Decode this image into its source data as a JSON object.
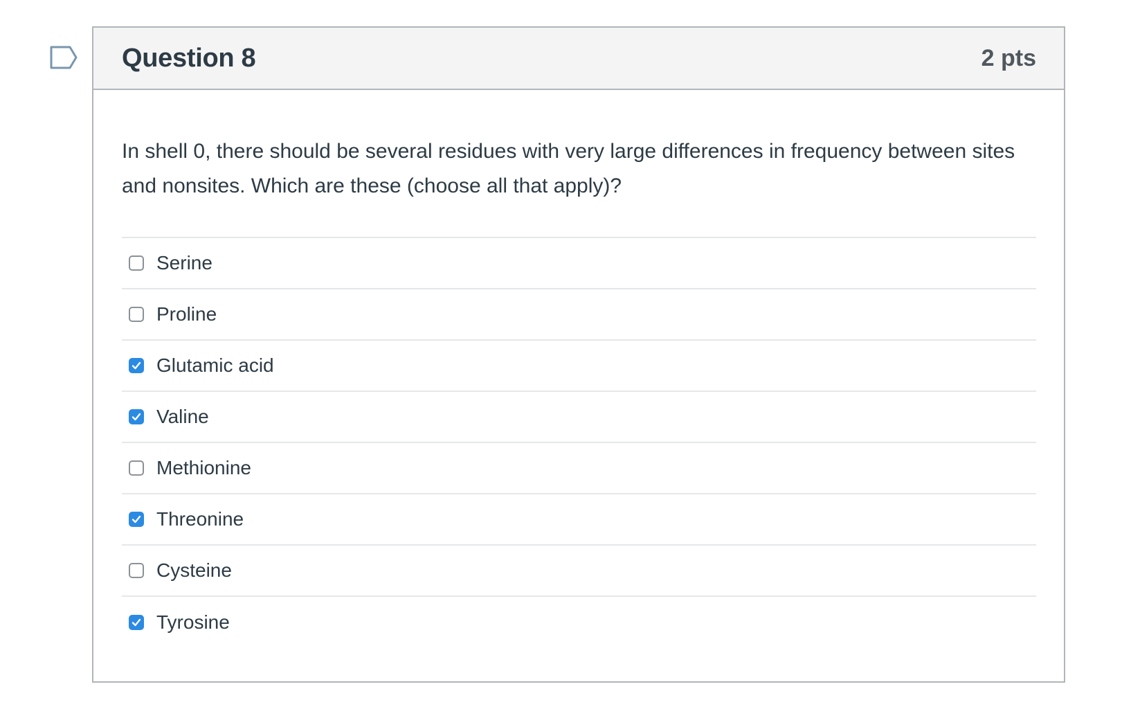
{
  "question": {
    "title": "Question 8",
    "points": "2 pts",
    "text": "In shell 0, there should be several residues with very large differences in frequency between sites and nonsites. Which are these (choose all that apply)?",
    "flag_icon": "flag-outline-icon"
  },
  "answers": [
    {
      "label": "Serine",
      "checked": false
    },
    {
      "label": "Proline",
      "checked": false
    },
    {
      "label": "Glutamic acid",
      "checked": true
    },
    {
      "label": "Valine",
      "checked": true
    },
    {
      "label": "Methionine",
      "checked": false
    },
    {
      "label": "Threonine",
      "checked": true
    },
    {
      "label": "Cysteine",
      "checked": false
    },
    {
      "label": "Tyrosine",
      "checked": true
    }
  ],
  "colors": {
    "checkbox_checked": "#2b8ae2",
    "text": "#2d3b45",
    "header_bg": "#f4f4f5",
    "border": "#b0b5b9"
  }
}
